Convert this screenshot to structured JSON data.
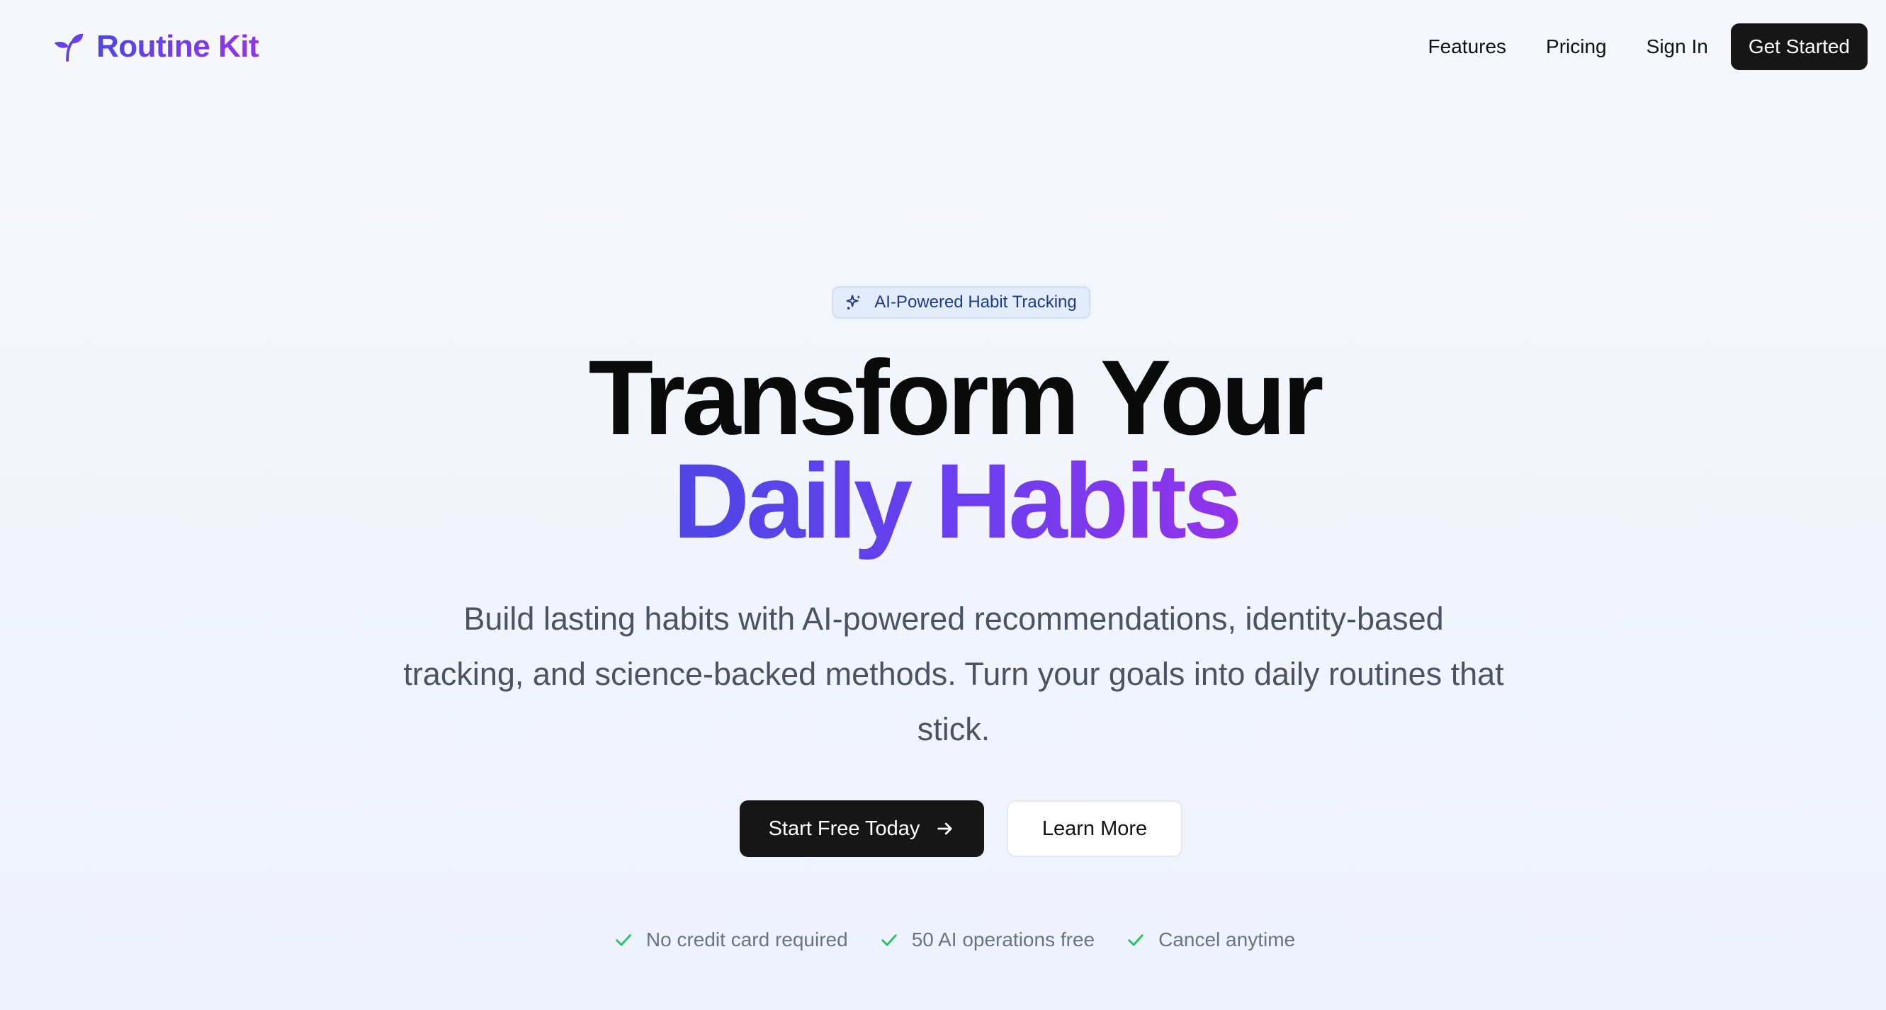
{
  "header": {
    "brand_name": "Routine Kit",
    "brand_icon": "sprout-icon",
    "nav": {
      "features": "Features",
      "pricing": "Pricing",
      "sign_in": "Sign In",
      "get_started": "Get Started"
    }
  },
  "hero": {
    "badge": {
      "icon": "sparkles-icon",
      "text": "AI-Powered Habit Tracking"
    },
    "headline_line1": "Transform Your",
    "headline_line2": "Daily Habits",
    "subtitle": "Build lasting habits with AI-powered recommendations, identity-based tracking, and science-backed methods. Turn your goals into daily routines that stick.",
    "cta_primary": "Start Free Today",
    "cta_primary_icon": "arrow-right-icon",
    "cta_secondary": "Learn More",
    "perks": [
      {
        "text": "No credit card required",
        "icon": "check-icon"
      },
      {
        "text": "50 AI operations free",
        "icon": "check-icon"
      },
      {
        "text": "Cancel anytime",
        "icon": "check-icon"
      }
    ]
  },
  "colors": {
    "background": "#eef2fd",
    "brand_gradient_start": "#4f46e5",
    "brand_gradient_end": "#9333ea",
    "primary_button": "#161616",
    "badge_background": "#e3ecfb",
    "badge_text": "#1e3a8a",
    "check_green": "#22c55e",
    "subtitle_text": "#4b5261"
  }
}
